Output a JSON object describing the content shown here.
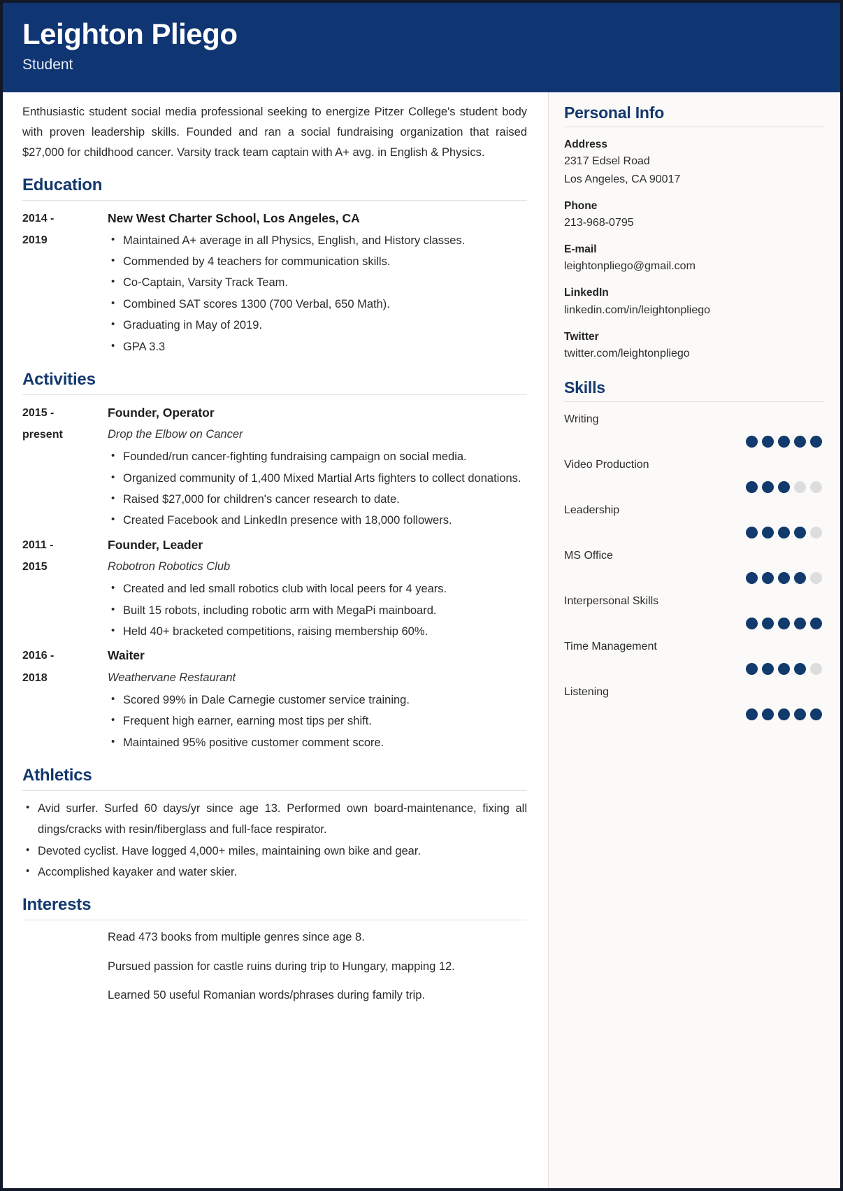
{
  "header": {
    "name": "Leighton Pliego",
    "job_title": "Student",
    "bg_color": "#0f3572"
  },
  "summary": "Enthusiastic student social media professional seeking to energize Pitzer College's student body with proven leadership skills. Founded and ran a social fundraising organization that raised $27,000 for childhood cancer. Varsity track team captain with A+ avg. in English & Physics.",
  "sections": {
    "education": {
      "heading": "Education",
      "entries": [
        {
          "date": "2014 - 2019",
          "date_line1": "2014 -",
          "date_line2": "2019",
          "title": "New West Charter School, Los Angeles, CA",
          "bullets": [
            "Maintained A+ average in all Physics, English, and History classes.",
            "Commended by 4 teachers for communication skills.",
            "Co-Captain, Varsity Track Team.",
            "Combined SAT scores 1300 (700 Verbal, 650 Math).",
            "Graduating in May of 2019.",
            "GPA 3.3"
          ]
        }
      ]
    },
    "activities": {
      "heading": "Activities",
      "entries": [
        {
          "date_line1": "2015 -",
          "date_line2": "present",
          "role": "Founder, Operator",
          "org": "Drop the Elbow on Cancer",
          "bullets": [
            "Founded/run cancer-fighting fundraising campaign on social media.",
            "Organized community of 1,400 Mixed Martial Arts fighters to collect donations.",
            "Raised $27,000 for children's cancer research to date.",
            "Created Facebook and LinkedIn presence with 18,000 followers."
          ]
        },
        {
          "date_line1": "2011 -",
          "date_line2": "2015",
          "role": "Founder, Leader",
          "org": "Robotron Robotics Club",
          "bullets": [
            "Created and led small robotics club with local peers for 4 years.",
            "Built 15 robots, including robotic arm with MegaPi mainboard.",
            "Held 40+ bracketed competitions, raising membership 60%."
          ]
        },
        {
          "date_line1": "2016 -",
          "date_line2": "2018",
          "role": "Waiter",
          "org": "Weathervane Restaurant",
          "bullets": [
            "Scored 99% in Dale Carnegie customer service training.",
            "Frequent high earner, earning most tips per shift.",
            "Maintained 95% positive customer comment score."
          ]
        }
      ]
    },
    "athletics": {
      "heading": "Athletics",
      "bullets": [
        "Avid surfer. Surfed 60 days/yr since age 13. Performed own board-maintenance, fixing all dings/cracks with resin/fiberglass and full-face respirator.",
        "Devoted cyclist. Have logged 4,000+ miles, maintaining own bike and gear.",
        "Accomplished kayaker and water skier."
      ]
    },
    "interests": {
      "heading": "Interests",
      "items": [
        "Read 473 books from multiple genres since age 8.",
        "Pursued passion for castle ruins during trip to Hungary, mapping 12.",
        "Learned 50 useful Romanian words/phrases during family trip."
      ]
    }
  },
  "sidebar": {
    "personal_info": {
      "heading": "Personal Info",
      "fields": [
        {
          "label": "Address",
          "value_line1": "2317 Edsel Road",
          "value_line2": "Los Angeles, CA 90017"
        },
        {
          "label": "Phone",
          "value_line1": "213-968-0795"
        },
        {
          "label": "E-mail",
          "value_line1": "leightonpliego@gmail.com"
        },
        {
          "label": "LinkedIn",
          "value_line1": "linkedin.com/in/leightonpliego"
        },
        {
          "label": "Twitter",
          "value_line1": "twitter.com/leightonpliego"
        }
      ]
    },
    "skills": {
      "heading": "Skills",
      "max_rating": 5,
      "items": [
        {
          "name": "Writing",
          "rating": 5
        },
        {
          "name": "Video Production",
          "rating": 3
        },
        {
          "name": "Leadership",
          "rating": 4
        },
        {
          "name": "MS Office",
          "rating": 4
        },
        {
          "name": "Interpersonal Skills",
          "rating": 5
        },
        {
          "name": "Time Management",
          "rating": 4
        },
        {
          "name": "Listening",
          "rating": 5
        }
      ],
      "dot_on_color": "#123a6d",
      "dot_off_color": "#dddddd"
    }
  }
}
